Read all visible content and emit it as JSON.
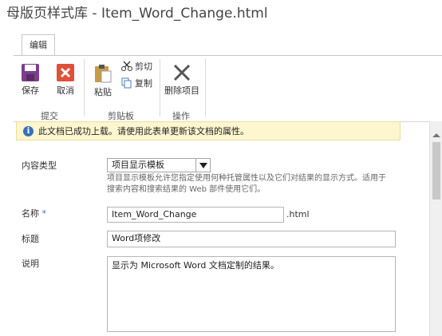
{
  "window": {
    "title": "母版页样式库 - Item_Word_Change.html"
  },
  "ribbon": {
    "tab_label": "编辑",
    "groups": {
      "commit": {
        "label": "提交",
        "save": "保存",
        "cancel": "取消"
      },
      "clipboard": {
        "label": "剪贴板",
        "paste": "粘贴",
        "cut": "剪切",
        "copy": "复制"
      },
      "actions": {
        "label": "操作",
        "delete": "删除项目"
      }
    }
  },
  "banner": {
    "text": "此文档已成功上载。请使用此表单更新该文档的属性。"
  },
  "form": {
    "content_type": {
      "label": "内容类型",
      "value": "项目显示模板",
      "help": "项目显示模板允许您指定使用何种托管属性以及它们对结果的显示方式。适用于搜索内容和搜索结果的 Web 部件使用它们。"
    },
    "name": {
      "label": "名称",
      "required_mark": "*",
      "value": "Item_Word_Change",
      "ext": ".html"
    },
    "title_field": {
      "label": "标题",
      "value": "Word项修改"
    },
    "description": {
      "label": "说明",
      "value": "显示为 Microsoft Word 文档定制的结果。"
    }
  },
  "colors": {
    "save_purple": "#7a3f8c",
    "cancel_red": "#e0503a",
    "info_blue": "#3a6fb7",
    "banner_bg": "#fdf6cf"
  }
}
